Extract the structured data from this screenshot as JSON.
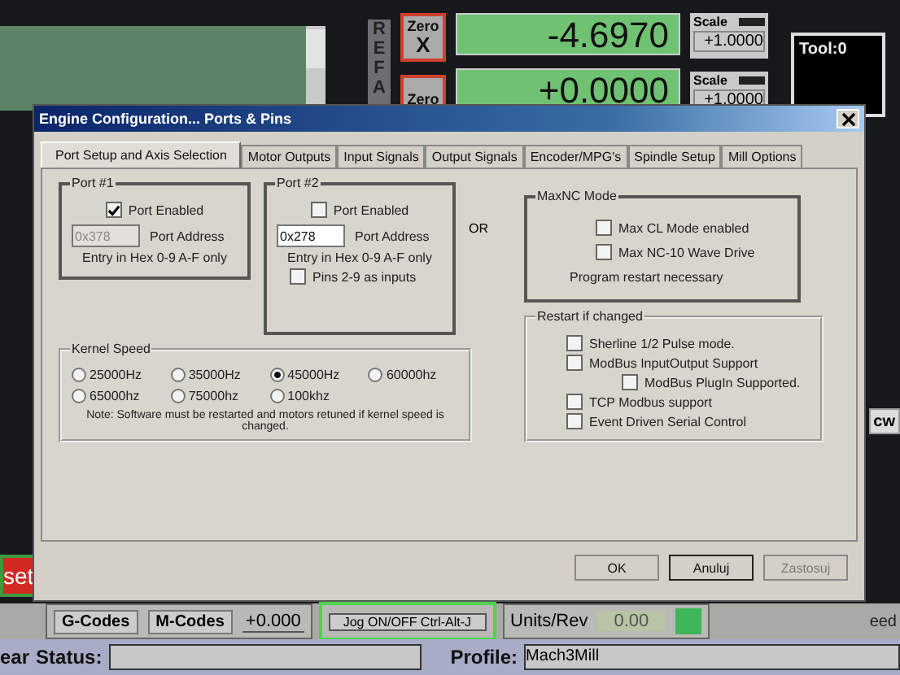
{
  "background": {
    "ref_letters": "REFA",
    "axes": [
      {
        "zero_label": "Zero",
        "axis": "X",
        "value": "-4.6970",
        "scale_label": "Scale",
        "scale": "+1.0000"
      },
      {
        "zero_label": "Zero",
        "value": "+0.0000",
        "scale_label": "Scale",
        "scale": "+1.0000"
      }
    ],
    "tool": "Tool:0",
    "reset_button": "set",
    "right_button": "cw",
    "right_label": "eed",
    "gcodes_button": "G-Codes",
    "mcodes_button": "M-Codes",
    "offset": "+0.000",
    "jog_button": "Jog ON/OFF Ctrl-Alt-J",
    "units_label": "Units/Rev",
    "units_value": "0.00",
    "clear_label": "ear",
    "status_label": "Status:",
    "profile_label": "Profile:",
    "profile": "Mach3Mill"
  },
  "dialog": {
    "title": "Engine Configuration... Ports & Pins",
    "tabs": [
      {
        "label": "Port Setup and Axis Selection",
        "selected": true
      },
      {
        "label": "Motor Outputs",
        "selected": false
      },
      {
        "label": "Input Signals",
        "selected": false
      },
      {
        "label": "Output Signals",
        "selected": false
      },
      {
        "label": "Encoder/MPG's",
        "selected": false
      },
      {
        "label": "Spindle Setup",
        "selected": false
      },
      {
        "label": "Mill Options",
        "selected": false
      }
    ],
    "port1": {
      "title": "Port #1",
      "enabled_label": "Port Enabled",
      "enabled": true,
      "address": "0x378",
      "address_label": "Port Address",
      "hint": "Entry in Hex 0-9 A-F only"
    },
    "port2": {
      "title": "Port #2",
      "enabled_label": "Port Enabled",
      "enabled": false,
      "address": "0x278",
      "address_label": "Port Address",
      "hint": "Entry in Hex 0-9 A-F only",
      "pins_label": "Pins 2-9 as inputs",
      "pins_inputs": false
    },
    "or_label": "OR",
    "maxnc": {
      "title": "MaxNC Mode",
      "options": [
        {
          "label": "Max CL Mode enabled",
          "checked": false
        },
        {
          "label": "Max NC-10 Wave Drive",
          "checked": false
        }
      ],
      "note": "Program restart necessary"
    },
    "kernel": {
      "title": "Kernel Speed",
      "options": [
        {
          "label": "25000Hz",
          "selected": false
        },
        {
          "label": "35000Hz",
          "selected": false
        },
        {
          "label": "45000Hz",
          "selected": true
        },
        {
          "label": "60000hz",
          "selected": false
        },
        {
          "label": "65000hz",
          "selected": false
        },
        {
          "label": "75000hz",
          "selected": false
        },
        {
          "label": "100khz",
          "selected": false
        }
      ],
      "note": "Note: Software must be restarted and motors retuned if kernel speed is changed."
    },
    "restart": {
      "title": "Restart if changed",
      "options": [
        {
          "label": "Sherline 1/2 Pulse mode.",
          "checked": false
        },
        {
          "label": "ModBus InputOutput Support",
          "checked": false,
          "children": [
            {
              "label": "ModBus PlugIn Supported.",
              "checked": false
            }
          ]
        },
        {
          "label": "TCP Modbus support",
          "checked": false
        },
        {
          "label": "Event Driven Serial Control",
          "checked": false
        }
      ]
    },
    "buttons": [
      {
        "label": "OK",
        "disabled": false,
        "default": false
      },
      {
        "label": "Anuluj",
        "disabled": false,
        "default": true
      },
      {
        "label": "Zastosuj",
        "disabled": true,
        "default": false
      }
    ]
  }
}
